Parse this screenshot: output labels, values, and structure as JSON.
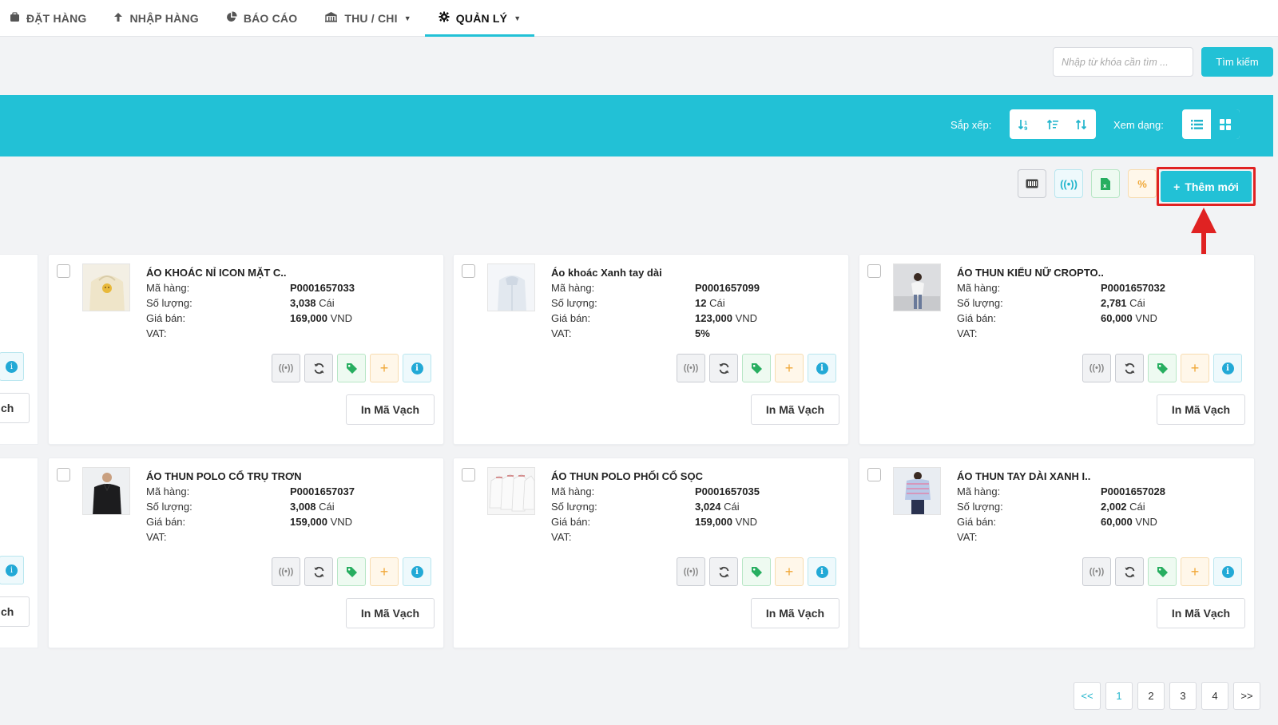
{
  "nav": [
    {
      "label": "ĐẶT HÀNG",
      "icon": "briefcase-icon"
    },
    {
      "label": "NHẬP HÀNG",
      "icon": "arrow-up-icon"
    },
    {
      "label": "BÁO CÁO",
      "icon": "pie-chart-icon"
    },
    {
      "label": "THU / CHI",
      "icon": "building-icon"
    },
    {
      "label": "QUẢN LÝ",
      "icon": "gear-icon",
      "active": true
    }
  ],
  "search": {
    "placeholder": "Nhập từ khóa cần tìm ...",
    "button": "Tìm kiếm"
  },
  "toolbar": {
    "sort_label": "Sắp xếp:",
    "view_label": "Xem dạng:"
  },
  "actions": {
    "add_label": "Thêm mới"
  },
  "products": [
    {
      "title": "ÁO KHOÁC NỈ ICON MẶT C..",
      "code_label": "Mã hàng:",
      "code": "P0001657033",
      "qty_label": "Số lượng:",
      "qty": "3,038",
      "unit": "Cái",
      "price_label": "Giá bán:",
      "price": "169,000",
      "currency": "VND",
      "vat_label": "VAT:",
      "vat": "",
      "print_label": "In Mã Vạch"
    },
    {
      "title": "Áo khoác Xanh tay dài",
      "code_label": "Mã hàng:",
      "code": "P0001657099",
      "qty_label": "Số lượng:",
      "qty": "12",
      "unit": "Cái",
      "price_label": "Giá bán:",
      "price": "123,000",
      "currency": "VND",
      "vat_label": "VAT:",
      "vat": "5%",
      "print_label": "In Mã Vạch"
    },
    {
      "title": "ÁO THUN KIỂU NỮ CROPTO..",
      "code_label": "Mã hàng:",
      "code": "P0001657032",
      "qty_label": "Số lượng:",
      "qty": "2,781",
      "unit": "Cái",
      "price_label": "Giá bán:",
      "price": "60,000",
      "currency": "VND",
      "vat_label": "VAT:",
      "vat": "",
      "print_label": "In Mã Vạch"
    },
    {
      "title": "ÁO THUN POLO CỔ TRỤ TRƠN",
      "code_label": "Mã hàng:",
      "code": "P0001657037",
      "qty_label": "Số lượng:",
      "qty": "3,008",
      "unit": "Cái",
      "price_label": "Giá bán:",
      "price": "159,000",
      "currency": "VND",
      "vat_label": "VAT:",
      "vat": "",
      "print_label": "In Mã Vạch"
    },
    {
      "title": "ÁO THUN POLO PHỐI CỔ SỌC",
      "code_label": "Mã hàng:",
      "code": "P0001657035",
      "qty_label": "Số lượng:",
      "qty": "3,024",
      "unit": "Cái",
      "price_label": "Giá bán:",
      "price": "159,000",
      "currency": "VND",
      "vat_label": "VAT:",
      "vat": "",
      "print_label": "In Mã Vạch"
    },
    {
      "title": "ÁO THUN TAY DÀI XANH I..",
      "code_label": "Mã hàng:",
      "code": "P0001657028",
      "qty_label": "Số lượng:",
      "qty": "2,002",
      "unit": "Cái",
      "price_label": "Giá bán:",
      "price": "60,000",
      "currency": "VND",
      "vat_label": "VAT:",
      "vat": "",
      "print_label": "In Mã Vạch"
    }
  ],
  "partial_print_label": "ch",
  "pagination": {
    "prev": "<<",
    "pages": [
      "1",
      "2",
      "3",
      "4"
    ],
    "next": ">>",
    "current": "1"
  },
  "colors": {
    "accent": "#22c1d6",
    "highlight": "#e02222"
  }
}
